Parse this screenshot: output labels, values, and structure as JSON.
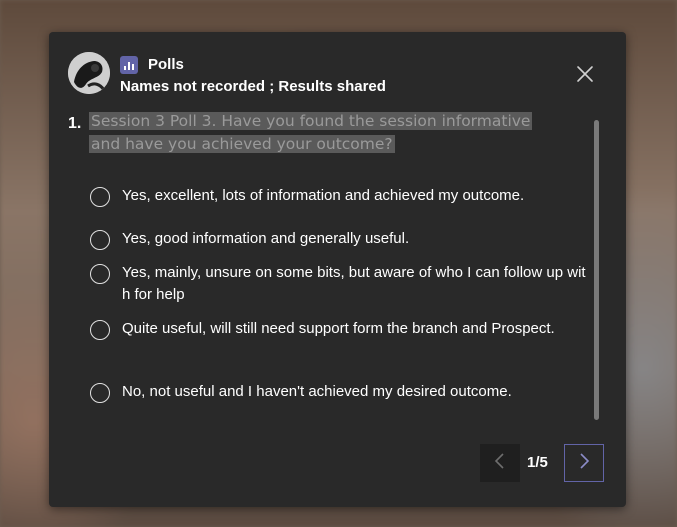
{
  "header": {
    "app_icon": "polls-bar-chart-icon",
    "app_name": "Polls",
    "subtitle": "Names not recorded ; Results shared",
    "close_icon": "close-icon"
  },
  "question": {
    "number": "1.",
    "text": "Session 3 Poll 3. Have you found the session informative and have you achieved your outcome?"
  },
  "options": [
    {
      "label": "Yes, excellent, lots of information and achieved my outcome."
    },
    {
      "label": "Yes, good information and generally useful."
    },
    {
      "label": "Yes, mainly, unsure on some bits, but aware of who I can follow up with for help"
    },
    {
      "label": "Quite useful, will still need support form the branch and Prospect."
    },
    {
      "label": "No, not useful and I haven't achieved my desired outcome."
    }
  ],
  "pager": {
    "text": "1/5",
    "prev_icon": "chevron-left-icon",
    "next_icon": "chevron-right-icon"
  },
  "colors": {
    "card_background": "#292929",
    "accent": "#6264a7",
    "question_highlight": "#5a5a5a"
  }
}
